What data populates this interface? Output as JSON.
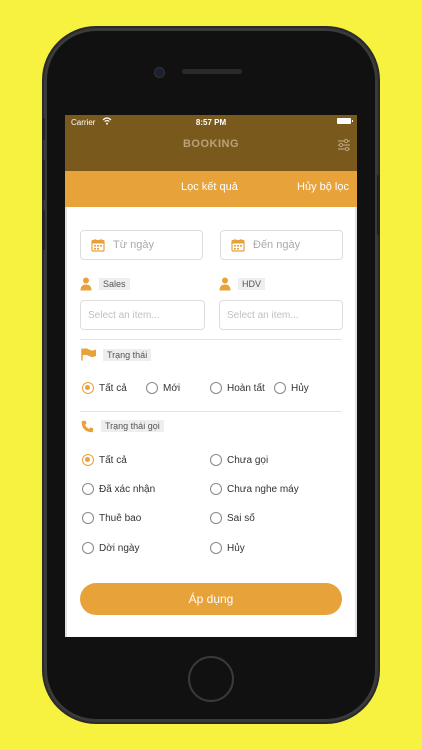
{
  "status_bar": {
    "carrier": "Carrier",
    "time": "8:57 PM"
  },
  "nav": {
    "title": "BOOKING"
  },
  "header": {
    "result_label": "Lọc kết quả",
    "clear_label": "Hủy bộ lọc"
  },
  "dates": {
    "from_placeholder": "Từ ngày",
    "to_placeholder": "Đến ngày"
  },
  "people": {
    "sales_label": "Sales",
    "hdv_label": "HDV",
    "sales_placeholder": "Select an item...",
    "hdv_placeholder": "Select an item..."
  },
  "status": {
    "label": "Trạng thái",
    "options": [
      {
        "label": "Tất cả",
        "selected": true
      },
      {
        "label": "Mới",
        "selected": false
      },
      {
        "label": "Hoàn tất",
        "selected": false
      },
      {
        "label": "Hủy",
        "selected": false
      }
    ]
  },
  "call_status": {
    "label": "Trạng thái gọi",
    "options": [
      {
        "label": "Tất cả",
        "selected": true
      },
      {
        "label": "Chưa gọi",
        "selected": false
      },
      {
        "label": "Đã xác nhận",
        "selected": false
      },
      {
        "label": "Chưa nghe máy",
        "selected": false
      },
      {
        "label": "Thuê bao",
        "selected": false
      },
      {
        "label": "Sai số",
        "selected": false
      },
      {
        "label": "Dời ngày",
        "selected": false
      },
      {
        "label": "Hủy",
        "selected": false
      }
    ]
  },
  "apply_label": "Áp dụng",
  "colors": {
    "accent": "#e8a23a",
    "background": "#f7f23f",
    "navbar": "#7a5a1c"
  }
}
